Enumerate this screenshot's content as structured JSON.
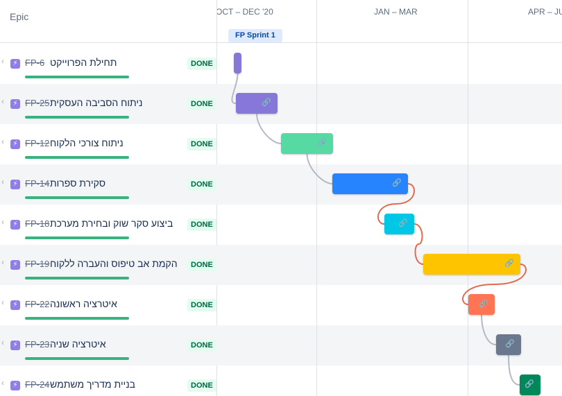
{
  "header": {
    "epic_column": "Epic"
  },
  "timeline": {
    "months": [
      "OCT – DEC '20",
      "JAN – MAR",
      "APR – JUN"
    ],
    "sprint": "FP Sprint 1"
  },
  "rows": [
    {
      "key": "FP-6",
      "name": "תחילת הפרוייקט",
      "status": "DONE",
      "color": "#8777d9",
      "progress": 1.0
    },
    {
      "key": "FP-25",
      "name": "ניתוח הסביבה העסקית",
      "status": "DONE",
      "color": "#8777d9",
      "progress": 1.0
    },
    {
      "key": "FP-12",
      "name": "ניתוח צורכי הלקוח",
      "status": "DONE",
      "color": "#57d9a3",
      "progress": 1.0
    },
    {
      "key": "FP-14",
      "name": "סקירת ספרות",
      "status": "DONE",
      "color": "#2684ff",
      "progress": 1.0
    },
    {
      "key": "FP-18",
      "name": "ביצוע סקר שוק ובחירת מערכת",
      "status": "DONE",
      "color": "#00c7e6",
      "progress": 1.0
    },
    {
      "key": "FP-19",
      "name": "הקמת אב טיפוס והעברה ללקוח",
      "status": "DONE",
      "color": "#ffc400",
      "progress": 1.0
    },
    {
      "key": "FP-22",
      "name": "איטרציה ראשונה",
      "status": "DONE",
      "color": "#ff7452",
      "progress": 1.0
    },
    {
      "key": "FP-23",
      "name": "איטרציה שניה",
      "status": "DONE",
      "color": "#6b778c",
      "progress": 1.0
    },
    {
      "key": "FP-24",
      "name": "בניית מדריך משתמש",
      "status": "DONE",
      "color": "#00875a",
      "progress": 1.0
    }
  ],
  "icons": {
    "epic": "lightning-icon",
    "link": "link-icon",
    "expand": "chevron-left-icon"
  }
}
